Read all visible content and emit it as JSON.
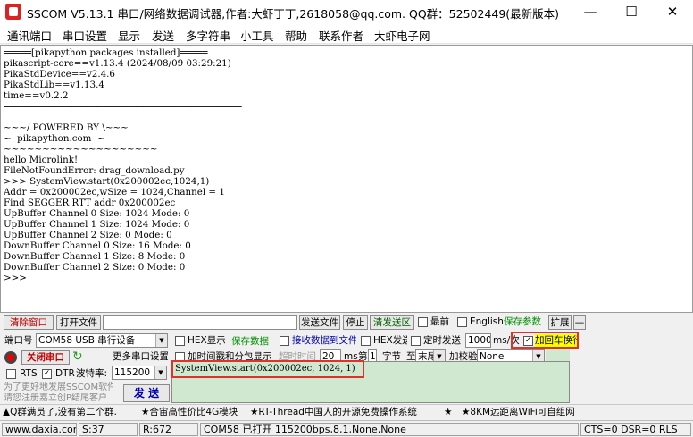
{
  "window": {
    "title": "SSCOM V5.13.1 串口/网络数据调试器,作者:大虾丁丁,2618058@qq.com. QQ群：52502449(最新版本)",
    "minimize": "—",
    "maximize": "☐",
    "close": "✕"
  },
  "menu": [
    "通讯端口",
    "串口设置",
    "显示",
    "发送",
    "多字符串",
    "小工具",
    "帮助",
    "联系作者",
    "大虾电子网"
  ],
  "terminal": {
    "lines": [
      "═════[pikapython packages installed]═════",
      "pikascript-core==v1.13.4 (2024/08/09 03:29:21)",
      "PikaStdDevice==v2.4.6",
      "PikaStdLib==v1.13.4",
      "time==v0.2.2",
      "═══════════════════════════════════════════",
      "",
      "~~~/ POWERED BY \\~~~",
      "~  pikapython.com  ~",
      "~~~~~~~~~~~~~~~~~~~~",
      "hello Microlink!",
      "FileNotFoundError: drag_download.py",
      ">>> SystemView.start(0x200002ec,1024,1)",
      "Addr = 0x200002ec,wSize = 1024,Channel = 1",
      "Find SEGGER RTT addr 0x200002ec",
      "UpBuffer Channel 0 Size: 1024 Mode: 0",
      "UpBuffer Channel 1 Size: 1024 Mode: 0",
      "UpBuffer Channel 2 Size: 0 Mode: 0",
      "DownBuffer Channel 0 Size: 16 Mode: 0",
      "DownBuffer Channel 1 Size: 8 Mode: 0",
      "DownBuffer Channel 2 Size: 0 Mode: 0",
      ">>>"
    ]
  },
  "toolbar": {
    "clear_window": "清除窗口",
    "open_file": "打开文件",
    "send_file": "发送文件",
    "stop": "停止",
    "clear_send": "清发送区",
    "latest": "最前",
    "english": "English",
    "save_params": "保存参数",
    "expand": "扩展",
    "minus": "—"
  },
  "controls": {
    "port_label": "端口号",
    "port_value": "COM58 USB 串行设备",
    "hex_display": "HEX显示",
    "save_data": "保存数据",
    "recv_to_file": "接收数据到文件",
    "hex_send": "HEX发送",
    "timed_send": "定时发送",
    "interval": "1000",
    "interval_unit": "ms/次",
    "add_crlf": "加回车换行",
    "close_port": "关闭串口",
    "more_settings": "更多串口设置",
    "add_timestamp": "加时间戳和分包显示",
    "timeout_label": "超时时间",
    "timeout_value": "20",
    "timeout_unit": "ms",
    "byte_no_prefix": "第",
    "byte_no_value": "1",
    "byte_no_unit": "字节",
    "to_label": "至",
    "to_value": "末尾",
    "checksum_label": "加校验",
    "checksum_value": "None",
    "rts": "RTS",
    "dtr": "DTR",
    "baud_label": "波特率:",
    "baud_value": "115200",
    "send_text": "SystemView.start(0x200002ec, 1024, 1)",
    "promo_line1": "为了更好地发展SSCOM软件",
    "promo_line2": "请您注册嘉立创P结尾客户",
    "send_button": "发 送"
  },
  "ticker": {
    "item1": "▲Q群满员了,没有第二个群.",
    "item2": "★合宙高性价比4G模块",
    "item3": "★RT-Thread中国人的开源免费操作系统",
    "item4": "★",
    "item5": "★8KM远距离WiFi可自组网"
  },
  "status": {
    "website": "www.daxia.com",
    "sent": "S:37",
    "received": "R:672",
    "port_status": "COM58 已打开  115200bps,8,1,None,None",
    "lines": "CTS=0 DSR=0 RLS"
  },
  "colors": {
    "accent_red": "#e0322a",
    "highlight_yellow": "#ffff00",
    "send_panel": "#cfe8cf"
  }
}
